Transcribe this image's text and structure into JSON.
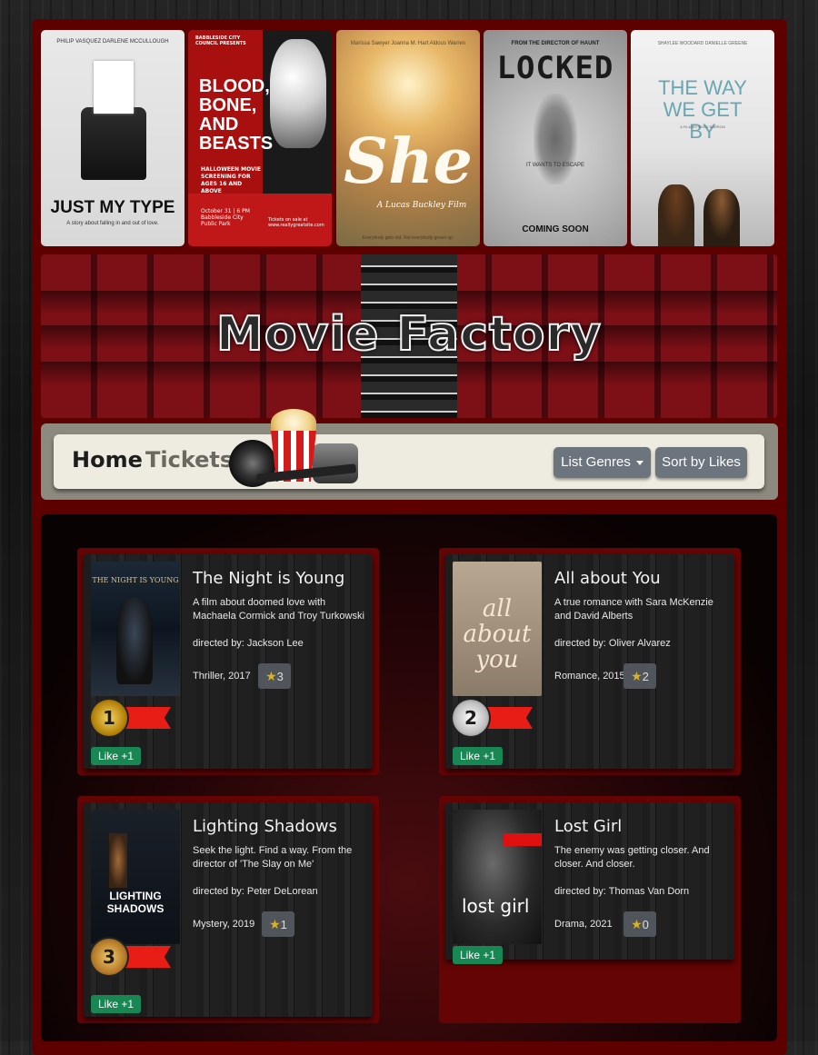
{
  "posters": [
    {
      "top": "PHILIP VASQUEZ    DARLENE MCCULLOUGH",
      "title": "JUST MY TYPE",
      "tagline": "A story about falling in and out of love."
    },
    {
      "top": "BABBLESIDE CITY COUNCIL PRESENTS",
      "title": "BLOOD, BONE, AND BEASTS",
      "sub": "HALLOWEEN MOVIE SCREENING FOR AGES 16 AND ABOVE",
      "date": "October 31 | 6 PM Babbleside City Public Park",
      "tickets": "Tickets on sale at www.reallygreatsite.com"
    },
    {
      "top": "Marissa Sawyer   Joanna M. Hart   Aldous Warren",
      "title": "She",
      "sub": "A Lucas Buckley Film",
      "footer": "Everybody gets old. Not everybody grows up."
    },
    {
      "top": "FROM THE DIRECTOR OF HAUNT",
      "title": "LOCKED",
      "sub": "IT WANTS TO ESCAPE",
      "footer": "COMING SOON"
    },
    {
      "top": "SHAYLEE WOODARD    DANIELLE GREENE",
      "title": "THE WAY WE GET BY",
      "sub": "A FILM BY REED BARRON"
    }
  ],
  "banner": {
    "title": "Movie Factory"
  },
  "nav": {
    "home": "Home",
    "tickets": "Tickets",
    "genres": "List Genres",
    "sort": "Sort by Likes"
  },
  "movies": [
    {
      "title": "The Night is Young",
      "desc": "A film about doomed love with Machaela Cormick and Troy Turkowski",
      "director": "directed by: Jackson Lee",
      "meta": "Thriller, 2017",
      "likes": "3",
      "rank": "1",
      "like_btn": "Like +1",
      "poster_text": "THE NIGHT IS YOUNG"
    },
    {
      "title": "All about You",
      "desc": "A true romance with Sara McKenzie and David Alberts",
      "director": "directed by: Oliver Alvarez",
      "meta": "Romance, 2015",
      "likes": "2",
      "rank": "2",
      "like_btn": "Like +1",
      "poster_text": "all about you"
    },
    {
      "title": "Lighting Shadows",
      "desc": "Seek the light. Find a way. From the director of 'The Slay on Me'",
      "director": "directed by: Peter DeLorean",
      "meta": "Mystery, 2019",
      "likes": "1",
      "rank": "3",
      "like_btn": "Like +1",
      "poster_text": "LIGHTING SHADOWS"
    },
    {
      "title": "Lost Girl",
      "desc": "The enemy was getting closer. And closer. And closer.",
      "director": "directed by: Thomas Van Dorn",
      "meta": "Drama, 2021",
      "likes": "0",
      "like_btn": "Like +1",
      "poster_text": "lost girl"
    }
  ]
}
